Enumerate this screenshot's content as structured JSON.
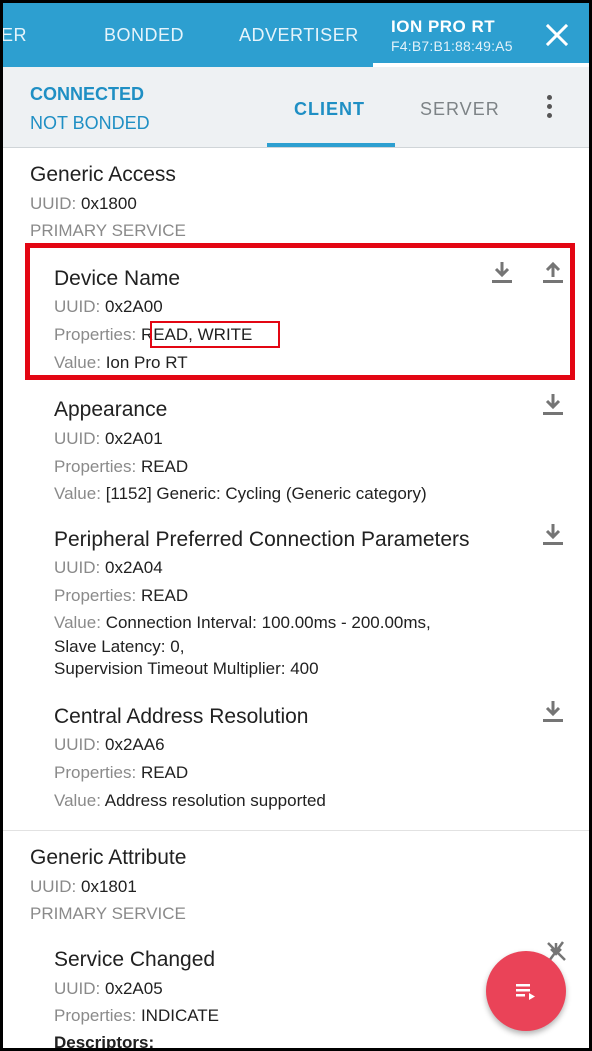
{
  "topbar": {
    "tabs": [
      {
        "label": "ER"
      },
      {
        "label": "BONDED"
      },
      {
        "label": "ADVERTISER"
      }
    ],
    "device": {
      "name": "ION PRO RT",
      "address": "F4:B7:B1:88:49:A5"
    },
    "close_icon": "close-icon"
  },
  "subbar": {
    "connection": "CONNECTED",
    "bond": "NOT BONDED",
    "client_tab": "CLIENT",
    "server_tab": "SERVER",
    "more_icon": "more-vert-icon"
  },
  "labels": {
    "uuid": "UUID:",
    "properties": "Properties:",
    "value": "Value:",
    "primary": "PRIMARY SERVICE",
    "descriptors": "Descriptors:"
  },
  "services": [
    {
      "name": "Generic Access",
      "uuid": "0x1800",
      "characteristics": [
        {
          "name": "Device Name",
          "uuid": "0x2A00",
          "properties": "READ, WRITE",
          "value": "Ion Pro RT"
        },
        {
          "name": "Appearance",
          "uuid": "0x2A01",
          "properties": "READ",
          "value": "[1152] Generic: Cycling (Generic category)"
        },
        {
          "name": "Peripheral Preferred Connection Parameters",
          "uuid": "0x2A04",
          "properties": "READ",
          "value_lines": [
            "Connection Interval: 100.00ms - 200.00ms,",
            "Slave Latency: 0,",
            "Supervision Timeout Multiplier: 400"
          ]
        },
        {
          "name": "Central Address Resolution",
          "uuid": "0x2AA6",
          "properties": "READ",
          "value": "Address resolution supported"
        }
      ]
    },
    {
      "name": "Generic Attribute",
      "uuid": "0x1801",
      "characteristics": [
        {
          "name": "Service Changed",
          "uuid": "0x2A05",
          "properties": "INDICATE"
        }
      ]
    }
  ],
  "highlight_color": "#e30613",
  "accent_color": "#2d9fd0",
  "fab_color": "#ea4358"
}
